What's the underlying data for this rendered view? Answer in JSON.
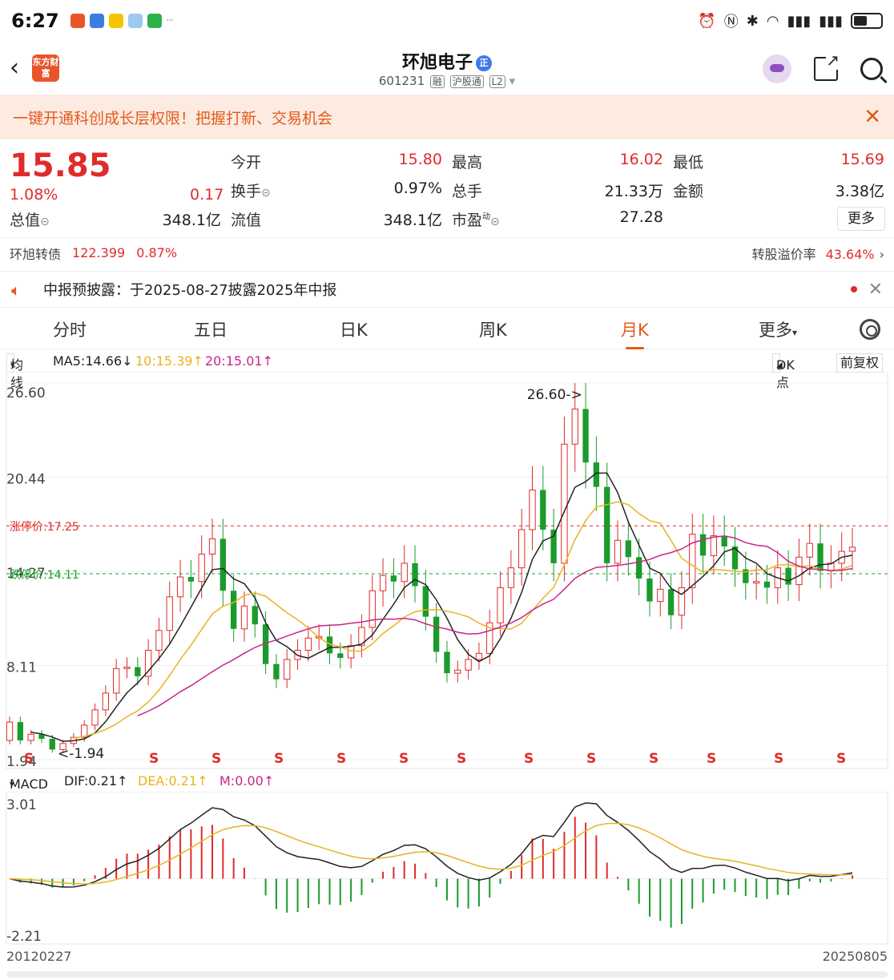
{
  "status": {
    "time": "6:27",
    "more": "···"
  },
  "nav": {
    "logo": "东方财富",
    "name": "环旭电子",
    "badge": "正",
    "code": "601231",
    "tags": [
      "融",
      "沪股通",
      "L2"
    ]
  },
  "banner": {
    "text": "一键开通科创成长层权限！把握打新、交易机会",
    "close": "✕"
  },
  "quote": {
    "price": "15.85",
    "pct": "1.08%",
    "change": "0.17",
    "open_label": "今开",
    "open": "15.80",
    "high_label": "最高",
    "high": "16.02",
    "low_label": "最低",
    "low": "15.69",
    "turnover_label": "换手",
    "turnover": "0.97%",
    "volume_label": "总手",
    "volume": "21.33万",
    "amount_label": "金额",
    "amount": "3.38亿",
    "mcap_label": "总值",
    "mcap": "348.1亿",
    "float_label": "流值",
    "float": "348.1亿",
    "pe_label": "市盈",
    "pe_sup": "动",
    "pe": "27.28",
    "more": "更多"
  },
  "bond": {
    "label": "环旭转债",
    "price": "122.399",
    "pct": "0.87%",
    "premium_label": "转股溢价率",
    "premium": "43.64%"
  },
  "notice": {
    "text": "中报预披露：于2025-08-27披露2025年中报",
    "close": "✕"
  },
  "tabs": [
    "分时",
    "五日",
    "日K",
    "周K",
    "月K",
    "更多"
  ],
  "active_tab": 4,
  "ma": {
    "label": "均线",
    "ma5": "MA5:14.66↓",
    "ma10": "10:15.39↑",
    "ma20": "20:15.01↑",
    "dk": "DK点",
    "fq": "前复权"
  },
  "macd": {
    "label": "MACD",
    "dif": "DIF:0.21↑",
    "dea": "DEA:0.21↑",
    "m": "M:0.00↑"
  },
  "colors": {
    "up": "#e02b2b",
    "down": "#1a9b2c",
    "accent": "#e25b1d",
    "ma5": "#222222",
    "ma10": "#e8b320",
    "ma20": "#c7268a"
  },
  "chart_data": {
    "type": "candlestick",
    "title": "",
    "period": "monthly",
    "x_start": "20120227",
    "x_end": "20250805",
    "ylim": [
      1.94,
      26.6
    ],
    "y_ticks": [
      "26.60",
      "20.44",
      "14.27",
      "8.11",
      "1.94"
    ],
    "limit_up_label": "涨停价:17.25",
    "limit_up": 17.25,
    "limit_down_label": "跌停价:14.11",
    "limit_down": 14.11,
    "max_label": "26.60",
    "min_label": "1.94",
    "signal_label": "S",
    "close": [
      4.4,
      3.2,
      3.6,
      3.3,
      2.6,
      3.0,
      3.4,
      4.2,
      5.2,
      6.3,
      7.9,
      8.0,
      7.4,
      9.1,
      10.4,
      12.6,
      13.9,
      13.6,
      15.4,
      16.4,
      13.0,
      10.5,
      12.0,
      10.8,
      8.2,
      7.2,
      8.5,
      9.1,
      9.9,
      10.0,
      8.9,
      8.6,
      9.4,
      10.6,
      13.0,
      14.0,
      13.6,
      14.8,
      13.3,
      11.3,
      9.0,
      7.6,
      7.8,
      8.5,
      8.9,
      10.9,
      13.2,
      14.5,
      17.0,
      19.6,
      17.0,
      14.8,
      22.6,
      24.9,
      21.4,
      19.8,
      14.8,
      16.3,
      15.2,
      13.8,
      12.3,
      13.1,
      11.4,
      13.2,
      16.7,
      15.3,
      16.6,
      15.9,
      14.4,
      13.5,
      13.6,
      13.2,
      14.5,
      13.4,
      15.2,
      16.1,
      14.3,
      14.8,
      15.58,
      15.85
    ],
    "macd": {
      "dif_range": [
        -2.21,
        3.01
      ]
    }
  }
}
